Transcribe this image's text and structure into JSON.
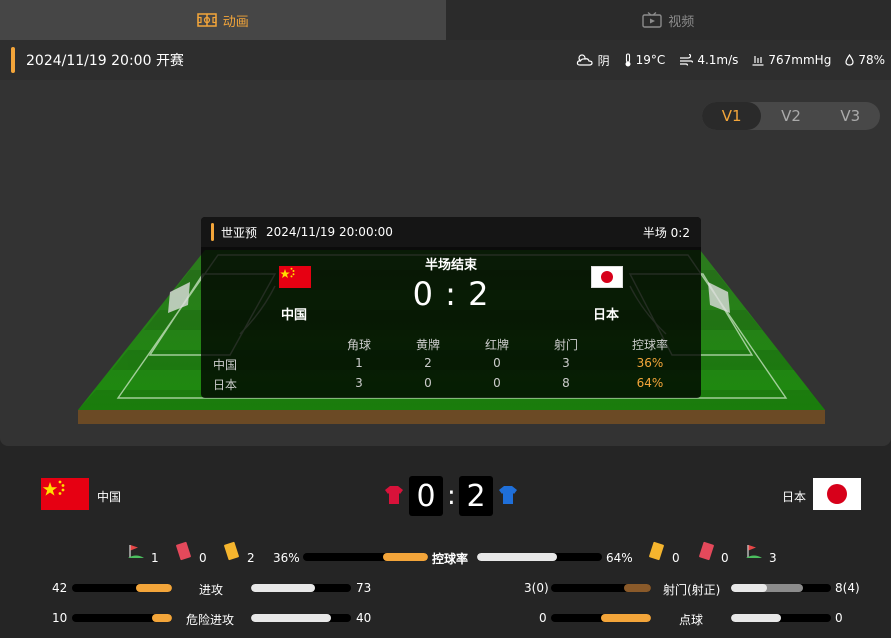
{
  "tabs": [
    {
      "label": "动画",
      "icon": "pitch-icon",
      "active": true
    },
    {
      "label": "视频",
      "icon": "video-icon",
      "active": false
    }
  ],
  "info": {
    "kickoff": "2024/11/19 20:00 开赛",
    "weather": "阴",
    "temperature": "19°C",
    "wind": "4.1m/s",
    "pressure": "767mmHg",
    "humidity": "78%"
  },
  "versions": [
    "V1",
    "V2",
    "V3"
  ],
  "active_version": "V1",
  "card": {
    "league": "世亚预",
    "datetime": "2024/11/19 20:00:00",
    "halftime": "半场 0:2",
    "status": "半场结束",
    "score": "0 : 2",
    "home": "中国",
    "away": "日本",
    "headers": [
      "角球",
      "黄牌",
      "红牌",
      "射门",
      "控球率"
    ],
    "rows": [
      {
        "team": "中国",
        "values": [
          "1",
          "2",
          "0",
          "3",
          "36%"
        ]
      },
      {
        "team": "日本",
        "values": [
          "3",
          "0",
          "0",
          "8",
          "64%"
        ]
      }
    ]
  },
  "scoreboard": {
    "home": "中国",
    "away": "日本",
    "home_score": "0",
    "away_score": "2",
    "colon": ":"
  },
  "events": {
    "home_corners": "1",
    "home_red": "0",
    "home_yellow": "2",
    "away_yellow": "0",
    "away_red": "0",
    "away_corners": "3"
  },
  "stats": {
    "possession": {
      "label": "控球率",
      "home": "36%",
      "away": "64%",
      "home_frac": 0.36,
      "away_frac": 0.64
    },
    "attack": {
      "label": "进攻",
      "home": "42",
      "away": "73"
    },
    "danger": {
      "label": "危险进攻",
      "home": "10",
      "away": "40"
    },
    "shots": {
      "label": "射门(射正)",
      "home": "3(0)",
      "away": "8(4)"
    },
    "penalty": {
      "label": "点球",
      "home": "0",
      "away": "0"
    }
  },
  "colors": {
    "accent": "#f3a53a",
    "china_red": "#e60012",
    "japan_red": "#d7001a",
    "pitch_green": "#1f8a12"
  }
}
